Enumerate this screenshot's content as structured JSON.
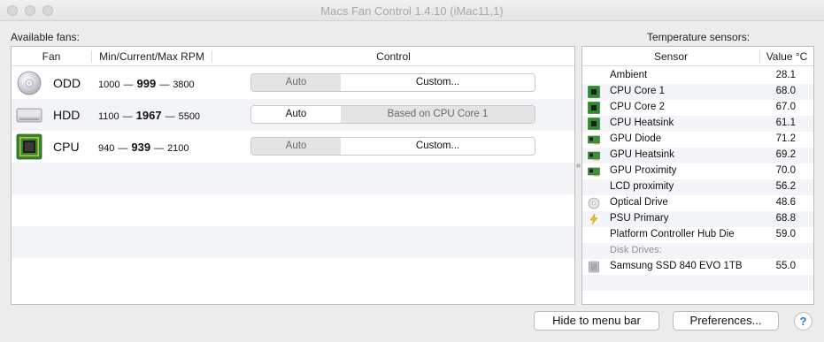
{
  "window": {
    "title": "Macs Fan Control 1.4.10 (iMac11,1)"
  },
  "fans": {
    "section_label": "Available fans:",
    "columns": {
      "fan": "Fan",
      "rpm": "Min/Current/Max RPM",
      "control": "Control"
    },
    "rows": [
      {
        "name": "ODD",
        "min": "1000",
        "current": "999",
        "max": "3800",
        "icon": "optical-drive-icon",
        "control_left": "Auto",
        "control_right": "Custom...",
        "active": "custom"
      },
      {
        "name": "HDD",
        "min": "1100",
        "current": "1967",
        "max": "5500",
        "icon": "hard-drive-icon",
        "control_left": "Auto",
        "control_right": "Based on CPU Core 1",
        "active": "auto"
      },
      {
        "name": "CPU",
        "min": "940",
        "current": "939",
        "max": "2100",
        "icon": "cpu-chip-icon",
        "control_left": "Auto",
        "control_right": "Custom...",
        "active": "custom"
      }
    ],
    "dash": "—"
  },
  "sensors": {
    "section_label": "Temperature sensors:",
    "columns": {
      "sensor": "Sensor",
      "value": "Value °C"
    },
    "rows": [
      {
        "name": "Ambient",
        "value": "28.1",
        "icon": ""
      },
      {
        "name": "CPU Core 1",
        "value": "68.0",
        "icon": "cpu-chip-icon"
      },
      {
        "name": "CPU Core 2",
        "value": "67.0",
        "icon": "cpu-chip-icon"
      },
      {
        "name": "CPU Heatsink",
        "value": "61.1",
        "icon": "cpu-chip-icon"
      },
      {
        "name": "GPU Diode",
        "value": "71.2",
        "icon": "gpu-card-icon"
      },
      {
        "name": "GPU Heatsink",
        "value": "69.2",
        "icon": "gpu-card-icon"
      },
      {
        "name": "GPU Proximity",
        "value": "70.0",
        "icon": "gpu-card-icon"
      },
      {
        "name": "LCD proximity",
        "value": "56.2",
        "icon": ""
      },
      {
        "name": "Optical Drive",
        "value": "48.6",
        "icon": "optical-drive-icon"
      },
      {
        "name": "PSU Primary",
        "value": "68.8",
        "icon": "lightning-icon"
      },
      {
        "name": "Platform Controller Hub Die",
        "value": "59.0",
        "icon": ""
      }
    ],
    "disk_group_label": "Disk Drives:",
    "disks": [
      {
        "name": "Samsung SSD 840 EVO 1TB",
        "value": "55.0",
        "icon": "ssd-icon"
      }
    ]
  },
  "buttons": {
    "hide": "Hide to menu bar",
    "preferences": "Preferences...",
    "help": "?"
  },
  "colors": {
    "row_alt": "#f2f4f7",
    "chip_green": "#2d8a2d",
    "help_blue": "#1f6fe0"
  }
}
